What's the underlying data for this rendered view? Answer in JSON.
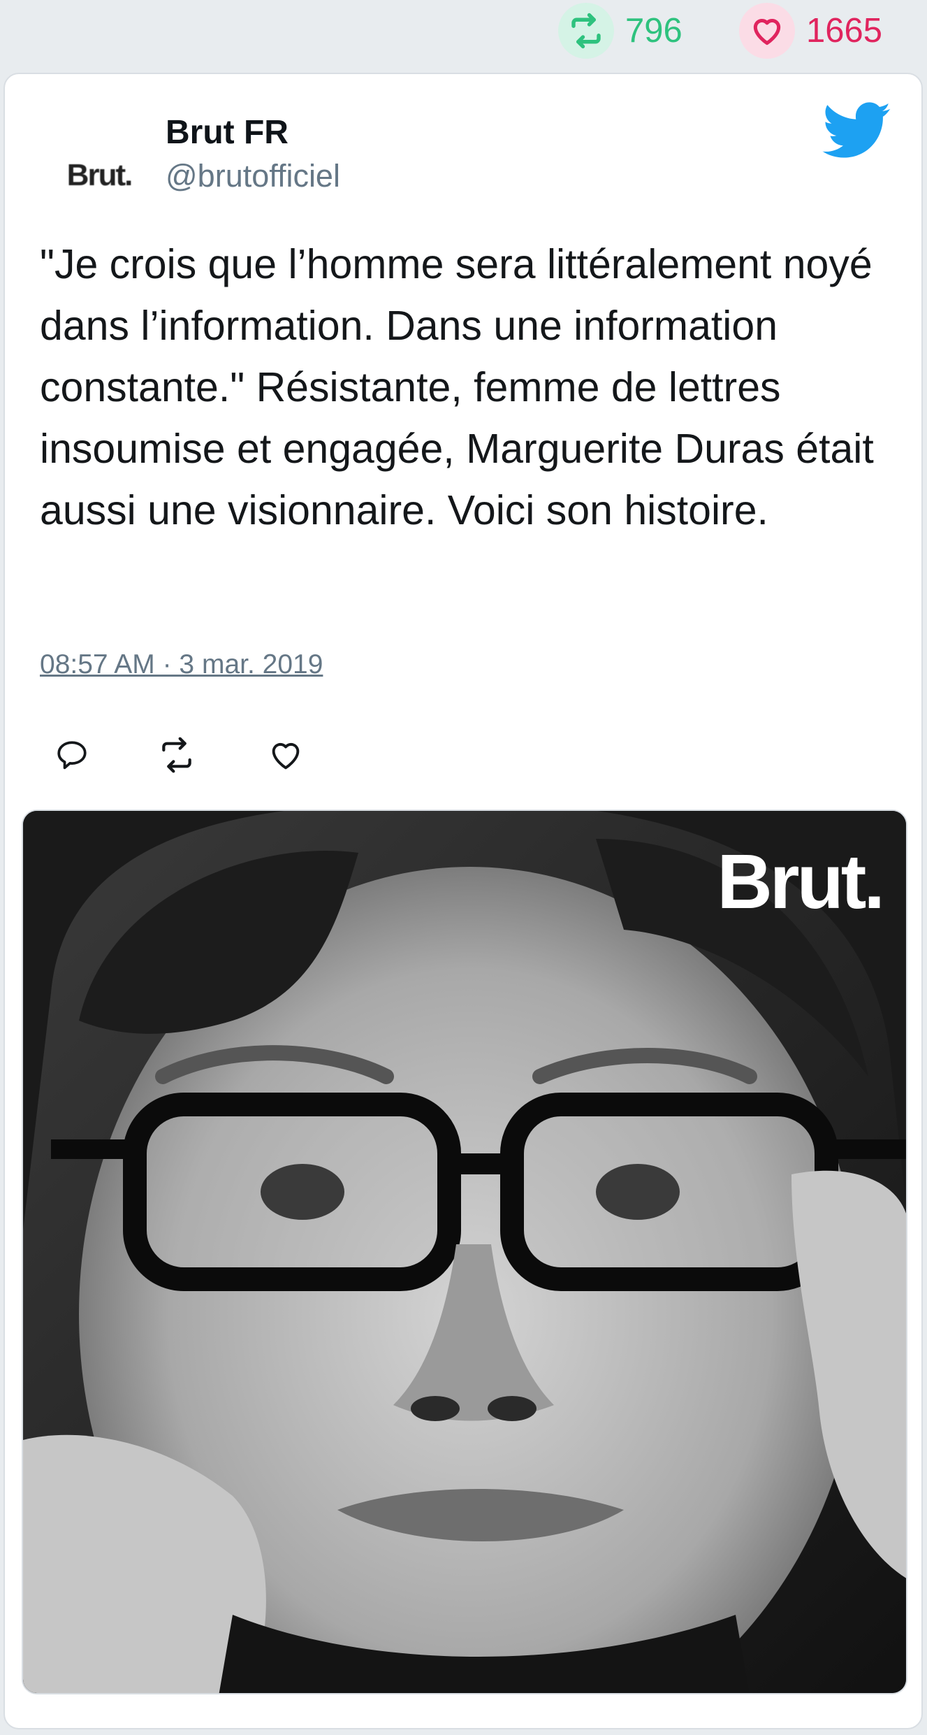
{
  "stats": {
    "retweets": "796",
    "likes": "1665",
    "retweet_icon": "retweet-icon",
    "like_icon": "heart-icon",
    "colors": {
      "retweet": "#2ec27e",
      "like": "#e0245e"
    }
  },
  "tweet": {
    "avatar_logo": "Brut.",
    "author_name": "Brut FR",
    "author_handle": "@brutofficiel",
    "text": "\"Je crois que l’homme sera littéralement noyé dans l’information. Dans une information constante.\" Résistante, femme de lettres insoumise et engagée, Marguerite Duras était aussi une visionnaire. Voici son histoire.",
    "timestamp": "08:57 AM · 3 mar. 2019",
    "actions": [
      "reply-icon",
      "retweet-icon",
      "like-icon"
    ],
    "brand_icon": "twitter-bird-icon",
    "brand_color": "#1da1f2"
  },
  "media": {
    "watermark": "Brut."
  }
}
